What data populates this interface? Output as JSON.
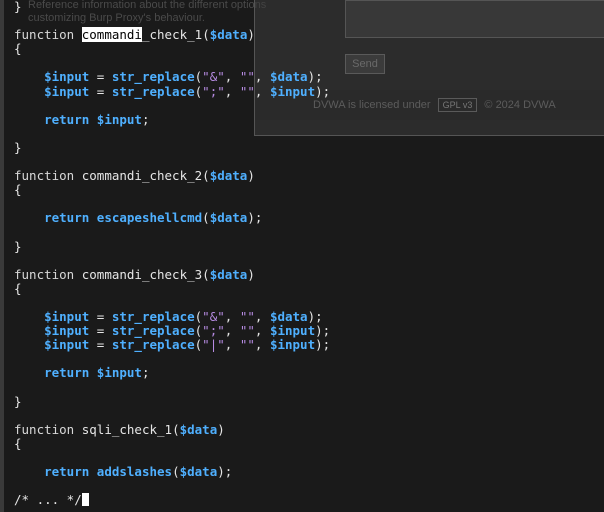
{
  "background_text": {
    "line1": "Reference information about the different options",
    "line2": "customizing Burp Proxy's behaviour."
  },
  "overlay": {
    "send_label": "Send",
    "footer_text": "DVWA is licensed under",
    "footer_badge": "GPL v3",
    "footer_right": "© 2024 DVWA"
  },
  "code": {
    "prev_close": "}",
    "func1": {
      "keyword": "function",
      "name_selected": "commandi",
      "name_rest": "_check_1",
      "param": "$data"
    },
    "func1_body": {
      "line1_var": "$input",
      "line1_call": "str_replace",
      "line1_s1": "\"&\"",
      "line1_s2": "\"\"",
      "line1_arg": "$data",
      "line2_var": "$input",
      "line2_call": "str_replace",
      "line2_s1": "\";\"",
      "line2_s2": "\"\"",
      "line2_arg": "$input",
      "return_kw": "return",
      "return_var": "$input"
    },
    "func2": {
      "keyword": "function",
      "name": "commandi_check_2",
      "param": "$data",
      "return_kw": "return",
      "return_call": "escapeshellcmd",
      "return_arg": "$data"
    },
    "func3": {
      "keyword": "function",
      "name": "commandi_check_3",
      "param": "$data",
      "l1_var": "$input",
      "l1_call": "str_replace",
      "l1_s1": "\"&\"",
      "l1_s2": "\"\"",
      "l1_arg": "$data",
      "l2_var": "$input",
      "l2_call": "str_replace",
      "l2_s1": "\";\"",
      "l2_s2": "\"\"",
      "l2_arg": "$input",
      "l3_var": "$input",
      "l3_call": "str_replace",
      "l3_s1": "\"|\"",
      "l3_s2": "\"\"",
      "l3_arg": "$input",
      "return_kw": "return",
      "return_var": "$input"
    },
    "func4": {
      "keyword": "function",
      "name": "sqli_check_1",
      "param": "$data",
      "return_kw": "return",
      "return_call": "addslashes",
      "return_arg": "$data"
    },
    "last_line": "/* ... */"
  }
}
